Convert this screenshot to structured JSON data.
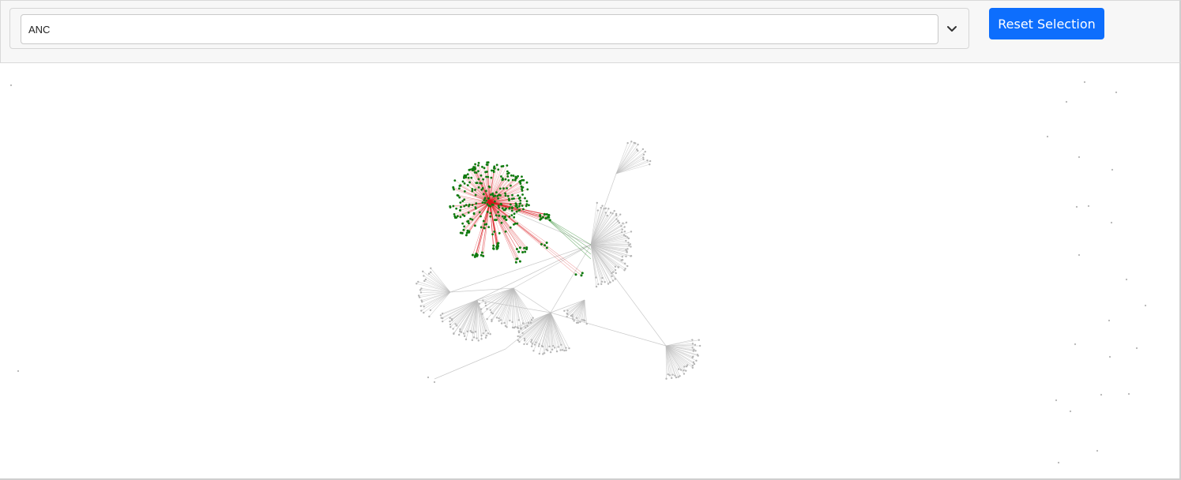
{
  "filter": {
    "selected_value": "ANC"
  },
  "toolbar": {
    "reset_label": "Reset Selection",
    "dropdown_icon": "chevron-down-icon"
  },
  "colors": {
    "accent": "#0d6efd",
    "selected_edge": "#d8141a",
    "selected_node": "#0f7a0f",
    "neighbor_edge": "#2e8b2e",
    "default_edge": "#bdbdbd",
    "default_node": "#b5b5b5"
  }
}
